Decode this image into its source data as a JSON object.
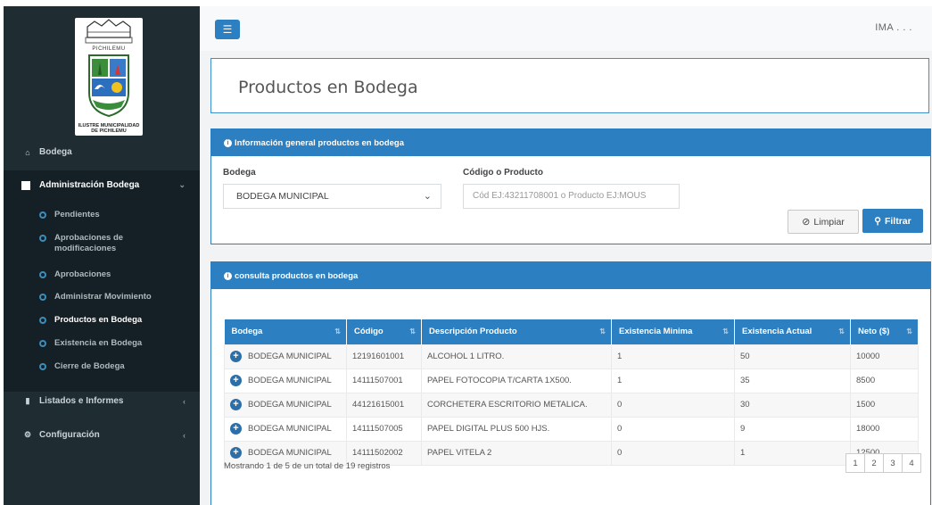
{
  "topbar": {
    "menu_icon": "bars-icon",
    "user": "IMA . . ."
  },
  "logo": {
    "city": "PICHILEMU",
    "caption_1": "ILUSTRE MUNICIPALIDAD",
    "caption_2": "DE PICHILEMU"
  },
  "sidebar": {
    "bodega": "Bodega",
    "admin": "Administración Bodega",
    "sub": [
      {
        "label": "Pendientes"
      },
      {
        "label": "Aprobaciones de modificaciones"
      },
      {
        "label": "Aprobaciones"
      },
      {
        "label": "Administrar Movimiento"
      },
      {
        "label": "Productos en Bodega"
      },
      {
        "label": "Existencia en Bodega"
      },
      {
        "label": "Cierre de Bodega"
      }
    ],
    "listados": "Listados e Informes",
    "config": "Configuración"
  },
  "page": {
    "title": "Productos en Bodega"
  },
  "info_panel": {
    "header": "Información general productos en bodega",
    "bodega_label": "Bodega",
    "bodega_value": "BODEGA MUNICIPAL",
    "codigo_label": "Código o Producto",
    "codigo_placeholder": "Cód EJ:43211708001 o Producto EJ:MOUS",
    "clear_label": "Limpiar",
    "filter_label": "Filtrar"
  },
  "list_panel": {
    "header": "consulta productos en bodega",
    "columns": [
      "Bodega",
      "Código",
      "Descripción Producto",
      "Existencia Minima",
      "Existencia Actual",
      "Neto ($)"
    ],
    "rows": [
      [
        "BODEGA MUNICIPAL",
        "12191601001",
        "ALCOHOL 1 LITRO.",
        "1",
        "50",
        "10000"
      ],
      [
        "BODEGA MUNICIPAL",
        "14111507001",
        "PAPEL FOTOCOPIA T/CARTA 1X500.",
        "1",
        "35",
        "8500"
      ],
      [
        "BODEGA MUNICIPAL",
        "44121615001",
        "CORCHETERA ESCRITORIO METALICA.",
        "0",
        "30",
        "1500"
      ],
      [
        "BODEGA MUNICIPAL",
        "14111507005",
        "PAPEL DIGITAL PLUS 500 HJS.",
        "0",
        "9",
        "18000"
      ],
      [
        "BODEGA MUNICIPAL",
        "14111502002",
        "PAPEL VITELA 2",
        "0",
        "1",
        "12500"
      ]
    ],
    "footer": "Mostrando 1 de 5 de un total de 19 registros",
    "pages": [
      "1",
      "2",
      "3",
      "4"
    ]
  }
}
